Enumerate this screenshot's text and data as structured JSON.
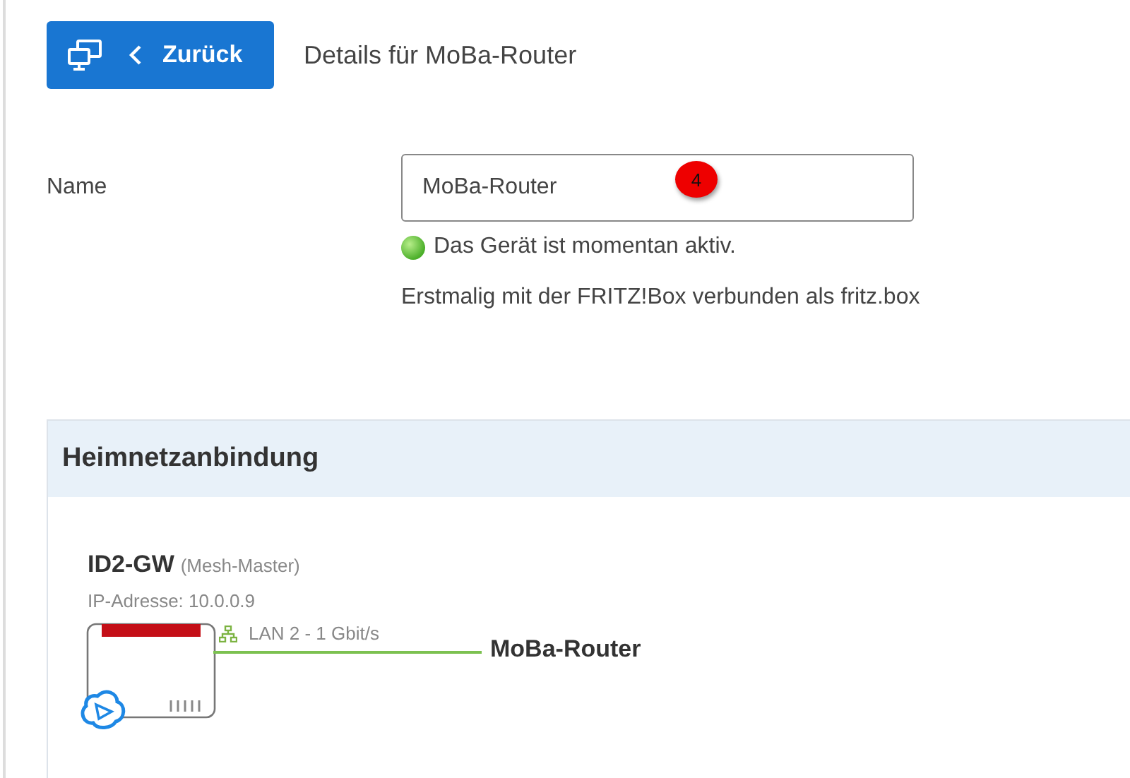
{
  "header": {
    "back_button": "Zurück",
    "title": "Details für MoBa-Router"
  },
  "name_field": {
    "label": "Name",
    "value": "MoBa-Router",
    "badge": "4"
  },
  "status": {
    "active": true,
    "text": "Das Gerät ist momentan aktiv."
  },
  "first_connected": "Erstmalig mit der FRITZ!Box verbunden als fritz.box",
  "home_network": {
    "title": "Heimnetzanbindung",
    "master_name": "ID2-GW",
    "master_role": "(Mesh-Master)",
    "ip": "IP-Adresse: 10.0.0.9",
    "link": "LAN 2  - 1 Gbit/s",
    "device": "MoBa-Router"
  }
}
